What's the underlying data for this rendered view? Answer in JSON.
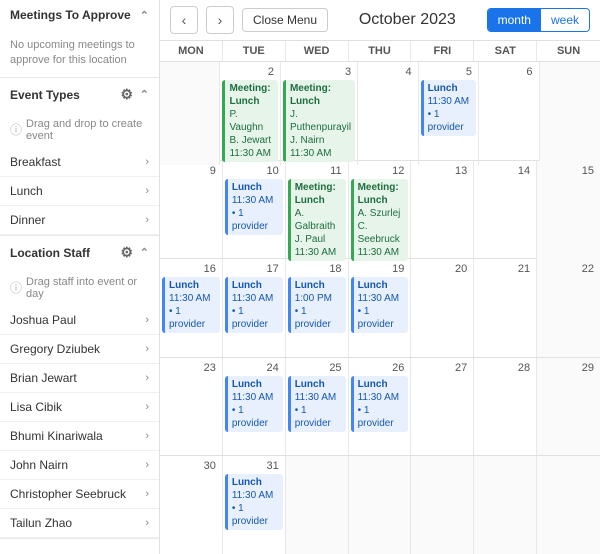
{
  "sidebar": {
    "meetings_section": {
      "title": "Meetings To Approve",
      "no_meetings_text": "No upcoming meetings to approve for this location"
    },
    "event_types_section": {
      "title": "Event Types",
      "hint": "Drag and drop to create event",
      "items": [
        {
          "label": "Breakfast"
        },
        {
          "label": "Lunch"
        },
        {
          "label": "Dinner"
        }
      ]
    },
    "location_staff_section": {
      "title": "Location Staff",
      "hint": "Drag staff into event or day",
      "staff": [
        {
          "name": "Joshua Paul"
        },
        {
          "name": "Gregory Dziubek"
        },
        {
          "name": "Brian Jewart"
        },
        {
          "name": "Lisa Cibik"
        },
        {
          "name": "Bhumi Kinariwala"
        },
        {
          "name": "John Nairn"
        },
        {
          "name": "Christopher Seebruck"
        },
        {
          "name": "Tailun Zhao"
        }
      ]
    }
  },
  "calendar": {
    "title": "October 2023",
    "close_button": "Close Menu",
    "month_btn": "month",
    "week_btn": "week",
    "day_headers": [
      "Mon",
      "Tue",
      "Wed",
      "Thu",
      "Fri",
      "Sat",
      "Sun"
    ],
    "weeks": [
      {
        "days": [
          {
            "num": "",
            "other": true,
            "events": []
          },
          {
            "num": "2",
            "events": [
              {
                "type": "green",
                "title": "Meeting: Lunch",
                "details": [
                  "P. Vaughn",
                  "B. Jewart",
                  "11:30 AM"
                ]
              }
            ]
          },
          {
            "num": "3",
            "events": [
              {
                "type": "green",
                "title": "Meeting: Lunch",
                "details": [
                  "J. Puthenpurayil",
                  "J. Nairn",
                  "11:30 AM"
                ]
              }
            ]
          },
          {
            "num": "4",
            "events": []
          },
          {
            "num": "5",
            "events": [
              {
                "type": "blue",
                "title": "Lunch",
                "details": [
                  "11:30 AM",
                  "• 1 provider"
                ]
              }
            ]
          },
          {
            "num": "6",
            "other": false,
            "events": []
          },
          {
            "num": "",
            "other": true,
            "events": []
          }
        ]
      },
      {
        "days": [
          {
            "num": "9",
            "events": []
          },
          {
            "num": "10",
            "events": [
              {
                "type": "blue",
                "title": "Lunch",
                "details": [
                  "11:30 AM",
                  "• 1 provider"
                ]
              }
            ]
          },
          {
            "num": "11",
            "events": [
              {
                "type": "green",
                "title": "Meeting: Lunch",
                "details": [
                  "A. Galbraith",
                  "J. Paul",
                  "11:30 AM"
                ]
              }
            ]
          },
          {
            "num": "12",
            "events": [
              {
                "type": "green",
                "title": "Meeting: Lunch",
                "details": [
                  "A. Szurlej",
                  "C. Seebruck",
                  "11:30 AM"
                ]
              }
            ]
          },
          {
            "num": "13",
            "events": []
          },
          {
            "num": "14",
            "events": []
          },
          {
            "num": "15",
            "other": true,
            "events": []
          }
        ]
      },
      {
        "days": [
          {
            "num": "16",
            "events": [
              {
                "type": "blue",
                "title": "Lunch",
                "details": [
                  "11:30 AM",
                  "• 1 provider"
                ]
              }
            ]
          },
          {
            "num": "17",
            "events": [
              {
                "type": "blue",
                "title": "Lunch",
                "details": [
                  "11:30 AM",
                  "• 1 provider"
                ]
              }
            ]
          },
          {
            "num": "18",
            "events": [
              {
                "type": "blue",
                "title": "Lunch",
                "details": [
                  "1:00 PM",
                  "• 1 provider"
                ]
              }
            ]
          },
          {
            "num": "19",
            "events": [
              {
                "type": "blue",
                "title": "Lunch",
                "details": [
                  "11:30 AM",
                  "• 1 provider"
                ]
              }
            ]
          },
          {
            "num": "20",
            "events": []
          },
          {
            "num": "21",
            "events": []
          },
          {
            "num": "22",
            "other": true,
            "events": []
          }
        ]
      },
      {
        "days": [
          {
            "num": "23",
            "events": []
          },
          {
            "num": "24",
            "events": [
              {
                "type": "blue",
                "title": "Lunch",
                "details": [
                  "11:30 AM",
                  "• 1 provider"
                ]
              }
            ]
          },
          {
            "num": "25",
            "events": [
              {
                "type": "blue",
                "title": "Lunch",
                "details": [
                  "11:30 AM",
                  "• 1 provider"
                ]
              }
            ]
          },
          {
            "num": "26",
            "events": [
              {
                "type": "blue",
                "title": "Lunch",
                "details": [
                  "11:30 AM",
                  "• 1 provider"
                ]
              }
            ]
          },
          {
            "num": "27",
            "events": []
          },
          {
            "num": "28",
            "events": []
          },
          {
            "num": "29",
            "other": true,
            "events": []
          }
        ]
      },
      {
        "days": [
          {
            "num": "30",
            "events": []
          },
          {
            "num": "31",
            "events": [
              {
                "type": "blue",
                "title": "Lunch",
                "details": [
                  "11:30 AM",
                  "• 1 provider"
                ]
              }
            ]
          },
          {
            "num": "",
            "other": true,
            "events": []
          },
          {
            "num": "",
            "other": true,
            "events": []
          },
          {
            "num": "",
            "other": true,
            "events": []
          },
          {
            "num": "",
            "other": true,
            "events": []
          },
          {
            "num": "",
            "other": true,
            "events": []
          }
        ]
      }
    ]
  }
}
